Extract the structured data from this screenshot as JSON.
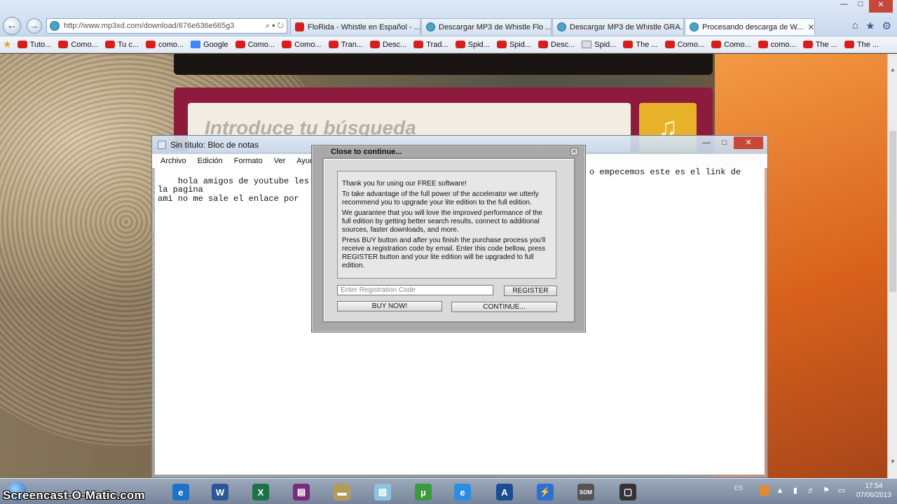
{
  "browser": {
    "url": "http://www.mp3xd.com/download/676e636e665g3",
    "address_tools": "⌕ ▾ ↻",
    "tabs": [
      {
        "label": "FloRida - Whistle en Español - ...",
        "icon": "youtube-icon"
      },
      {
        "label": "Descargar MP3 de Whistle Flo ...",
        "icon": "globe-icon"
      },
      {
        "label": "Descargar MP3 de Whistle GRA...",
        "icon": "globe-icon"
      },
      {
        "label": "Procesando descarga de W...",
        "icon": "globe-icon"
      }
    ],
    "tab_close": "✕",
    "window_controls": {
      "min": "—",
      "max": "□",
      "close": "✕"
    },
    "tools": {
      "home": "⌂",
      "star": "★",
      "gear": "⚙"
    },
    "favorites": [
      {
        "label": "Tuto...",
        "icon": "youtube-icon"
      },
      {
        "label": "Como...",
        "icon": "youtube-icon"
      },
      {
        "label": "Tu c...",
        "icon": "youtube-icon"
      },
      {
        "label": "como...",
        "icon": "youtube-icon"
      },
      {
        "label": "Google",
        "icon": "google-icon"
      },
      {
        "label": "Como...",
        "icon": "youtube-icon"
      },
      {
        "label": "Como...",
        "icon": "youtube-icon"
      },
      {
        "label": "Tran...",
        "icon": "youtube-icon"
      },
      {
        "label": "Desc...",
        "icon": "youtube-icon"
      },
      {
        "label": "Trad...",
        "icon": "youtube-icon"
      },
      {
        "label": "Spid...",
        "icon": "youtube-icon"
      },
      {
        "label": "Spid...",
        "icon": "youtube-icon"
      },
      {
        "label": "Desc...",
        "icon": "youtube-icon"
      },
      {
        "label": "Spid...",
        "icon": "document-icon"
      },
      {
        "label": "The ...",
        "icon": "youtube-icon"
      },
      {
        "label": "Como...",
        "icon": "youtube-icon"
      },
      {
        "label": "Como...",
        "icon": "youtube-icon"
      },
      {
        "label": "como...",
        "icon": "youtube-icon"
      },
      {
        "label": "The ...",
        "icon": "youtube-icon"
      },
      {
        "label": "The ...",
        "icon": "youtube-icon"
      }
    ]
  },
  "site": {
    "search_placeholder": "Introduce tu búsqueda"
  },
  "notepad": {
    "title": "Sin título: Bloc de notas",
    "menu": [
      "Archivo",
      "Edición",
      "Formato",
      "Ver",
      "Ayuda"
    ],
    "text_left": "hola amigos de youtube les en\nla pagina\nami no me sale el enlace por",
    "text_right": "o empecemos este es el link de"
  },
  "dialog": {
    "title": "Close to continue...",
    "close": "✕",
    "paragraphs": [
      "Thank you for using our FREE software!",
      "To take advantage of the full power of the accelerator we utterly recommend you to upgrade your lite edition to the full edition.",
      "We guarantee that you will love the improved performance of the full edition by getting better search results, connect to additional sources, faster downloads, and more.",
      "Press BUY button and after you finish the purchase process you'll receive a registration code by email. Enter this code bellow, press REGISTER button and your lite edition will be upgraded to full edition."
    ],
    "registration_placeholder": "Enter Registration Code",
    "register_label": "REGISTER",
    "buy_label": "BUY NOW!",
    "continue_label": "CONTINUE..."
  },
  "taskbar": {
    "watermark": "Screencast-O-Matic.com",
    "language": "ES",
    "time": "17:54",
    "date": "07/06/2013",
    "apps": [
      {
        "name": "ie-icon",
        "glyph": "e",
        "color": "#1e73c8"
      },
      {
        "name": "word-icon",
        "glyph": "W",
        "color": "#2b5797"
      },
      {
        "name": "excel-icon",
        "glyph": "X",
        "color": "#1e7145"
      },
      {
        "name": "winrar-icon",
        "glyph": "▤",
        "color": "#7a2b7e"
      },
      {
        "name": "drive-icon",
        "glyph": "▬",
        "color": "#b59b5a"
      },
      {
        "name": "notepad-icon",
        "glyph": "▧",
        "color": "#8fc2df"
      },
      {
        "name": "utorrent-icon",
        "glyph": "µ",
        "color": "#3a9b3a"
      },
      {
        "name": "ie-window-icon",
        "glyph": "e",
        "color": "#2d8de0"
      },
      {
        "name": "ares-icon",
        "glyph": "A",
        "color": "#1b4d91"
      },
      {
        "name": "accelerator-icon",
        "glyph": "⚡",
        "color": "#2f6fd0"
      },
      {
        "name": "som-icon",
        "glyph": "SOM",
        "color": "#555555"
      },
      {
        "name": "snipping-icon",
        "glyph": "▢",
        "color": "#333333"
      }
    ]
  }
}
